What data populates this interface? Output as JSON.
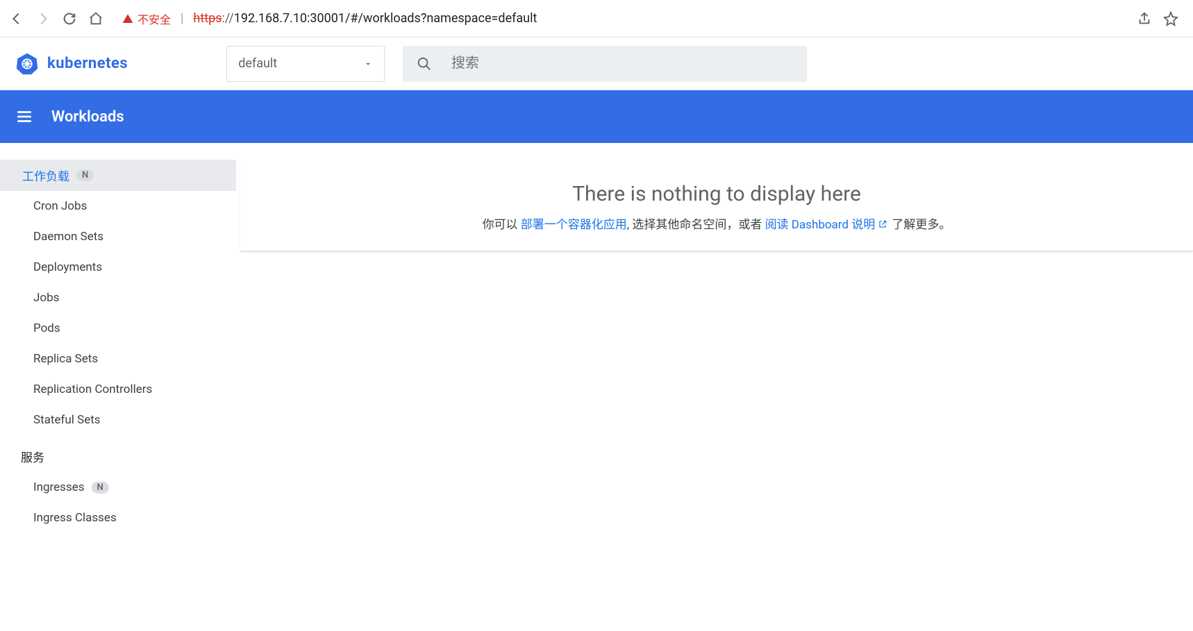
{
  "browser": {
    "security_label": "不安全",
    "url_scheme": "https",
    "url_slashes": "://",
    "url_host_path": "192.168.7.10:30001/#/workloads?namespace=default"
  },
  "topbar": {
    "logo_text": "kubernetes",
    "namespace_selected": "default",
    "search_placeholder": "搜索"
  },
  "bluebar": {
    "title": "Workloads"
  },
  "sidebar": {
    "group1_label": "工作负载",
    "group1_badge": "N",
    "items1": [
      {
        "label": "Cron Jobs"
      },
      {
        "label": "Daemon Sets"
      },
      {
        "label": "Deployments"
      },
      {
        "label": "Jobs"
      },
      {
        "label": "Pods"
      },
      {
        "label": "Replica Sets"
      },
      {
        "label": "Replication Controllers"
      },
      {
        "label": "Stateful Sets"
      }
    ],
    "group2_label": "服务",
    "items2": [
      {
        "label": "Ingresses",
        "badge": "N"
      },
      {
        "label": "Ingress Classes"
      }
    ]
  },
  "main": {
    "empty_title": "There is nothing to display here",
    "empty_prefix": "你可以 ",
    "empty_link1": "部署一个容器化应用",
    "empty_middle": ", 选择其他命名空间，或者 ",
    "empty_link2": "阅读 Dashboard 说明",
    "empty_suffix": " 了解更多。"
  }
}
